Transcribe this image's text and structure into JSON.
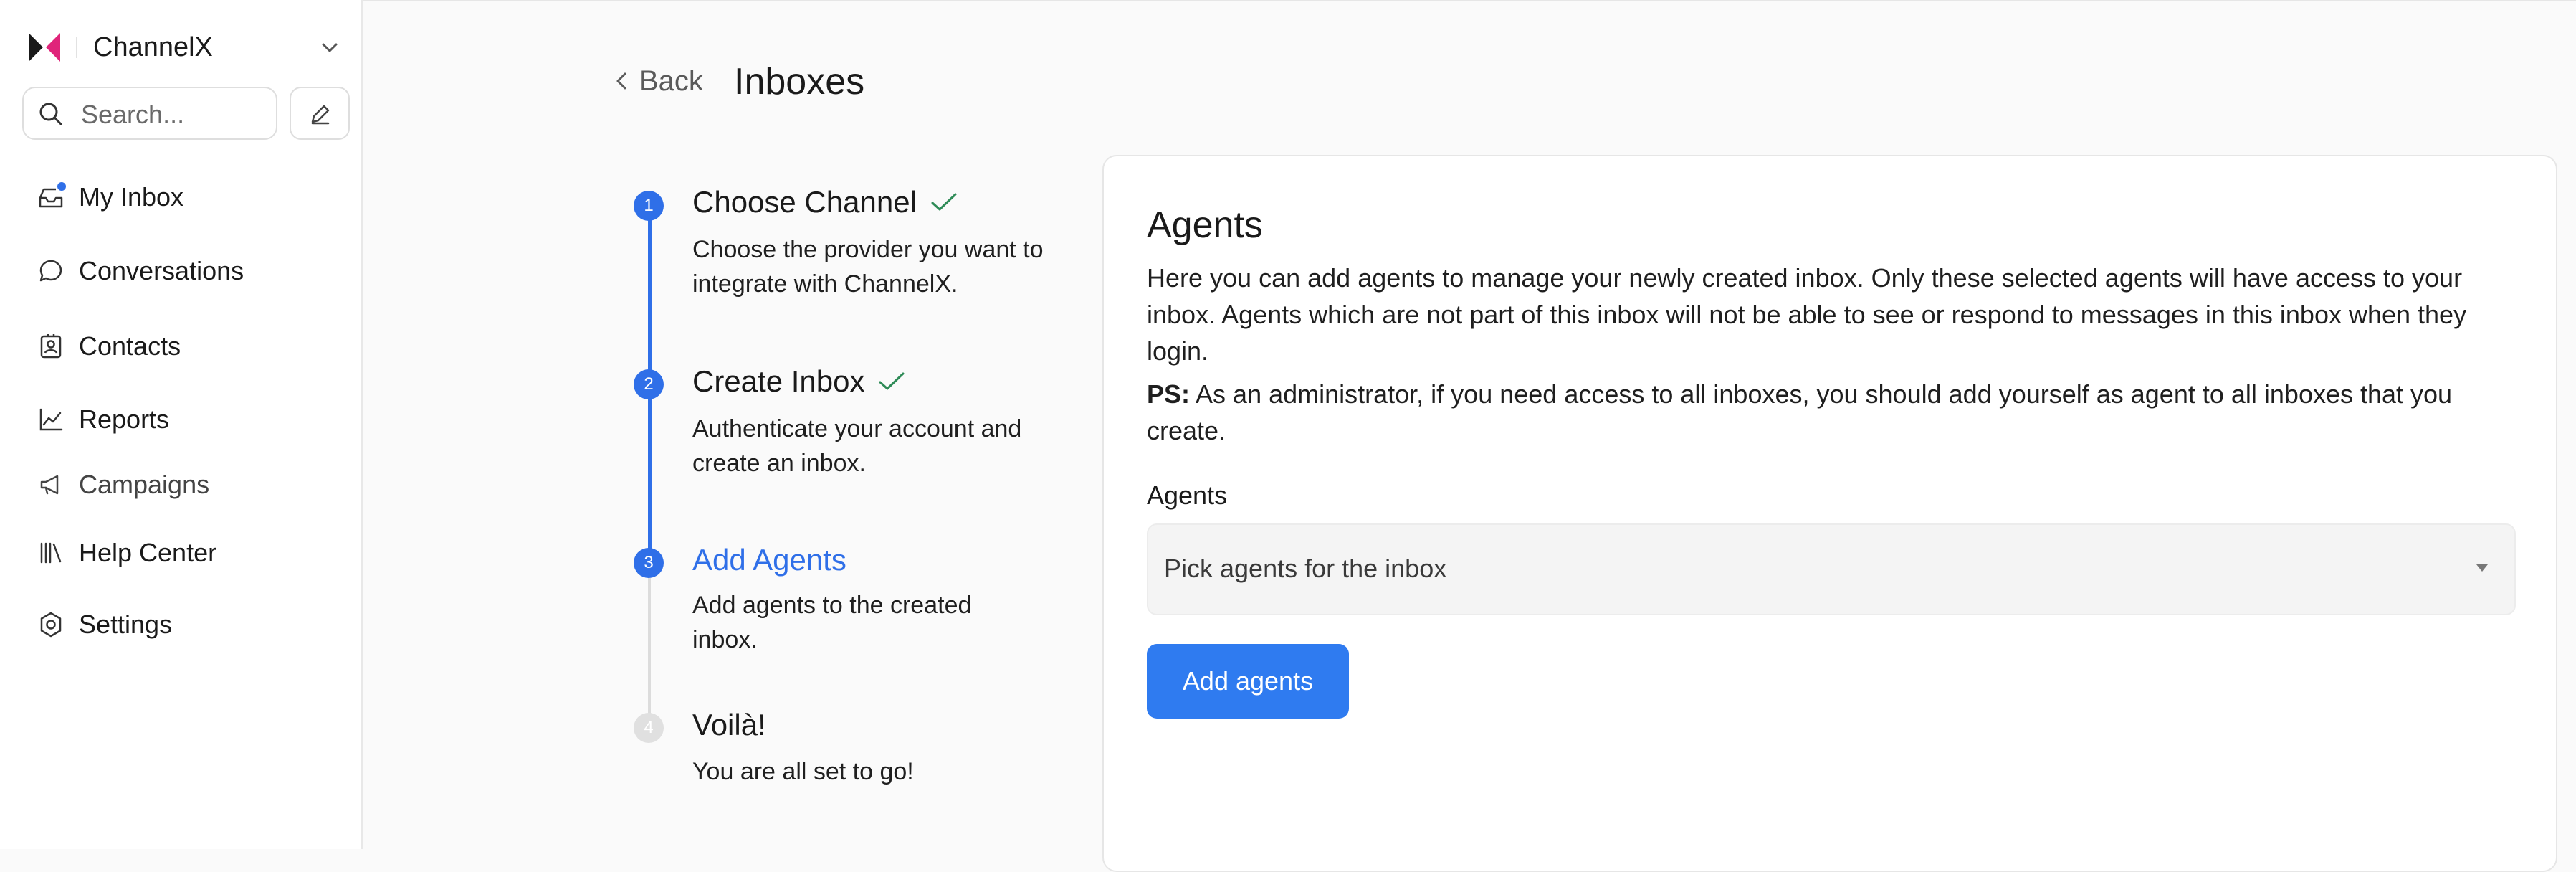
{
  "app": {
    "name": "ChannelX"
  },
  "search": {
    "placeholder": "Search..."
  },
  "sidebar": {
    "items": [
      {
        "label": "My Inbox",
        "icon": "inbox-icon"
      },
      {
        "label": "Conversations",
        "icon": "chat-bubble-icon"
      },
      {
        "label": "Contacts",
        "icon": "contact-card-icon"
      },
      {
        "label": "Reports",
        "icon": "line-chart-icon"
      },
      {
        "label": "Campaigns",
        "icon": "megaphone-icon"
      },
      {
        "label": "Help Center",
        "icon": "library-books-icon"
      },
      {
        "label": "Settings",
        "icon": "settings-gear-icon"
      }
    ]
  },
  "header": {
    "back_label": "Back",
    "title": "Inboxes"
  },
  "steps": [
    {
      "number": "1",
      "title": "Choose Channel",
      "desc": "Choose the provider you want to integrate with ChannelX.",
      "state": "done"
    },
    {
      "number": "2",
      "title": "Create Inbox",
      "desc": "Authenticate your account and create an inbox.",
      "state": "done"
    },
    {
      "number": "3",
      "title": "Add Agents",
      "desc": "Add agents to the created inbox.",
      "state": "active"
    },
    {
      "number": "4",
      "title": "Voilà!",
      "desc": "You are all set to go!",
      "state": "todo"
    }
  ],
  "card": {
    "title": "Agents",
    "description": "Here you can add agents to manage your newly created inbox. Only these selected agents will have access to your inbox. Agents which are not part of this inbox will not be able to see or respond to messages in this inbox when they login.",
    "note_prefix": "PS:",
    "note_text": " As an administrator, if you need access to all inboxes, you should add yourself as agent to all inboxes that you create.",
    "field_label": "Agents",
    "select_placeholder": "Pick agents for the inbox",
    "button_label": "Add agents"
  },
  "colors": {
    "accent": "#2f6fe8",
    "button": "#2f7bf0",
    "check": "#2e8b57",
    "logo_pink": "#e0247a"
  }
}
